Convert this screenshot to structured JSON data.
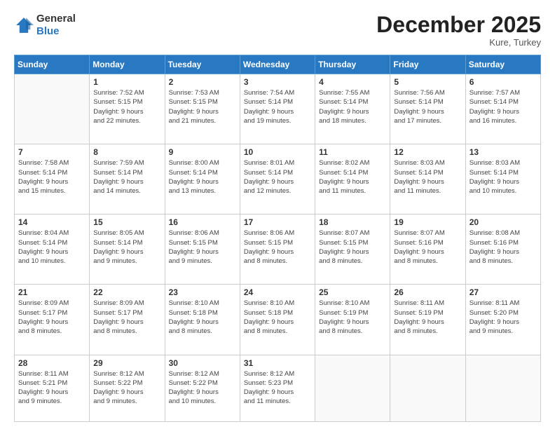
{
  "header": {
    "logo_line1": "General",
    "logo_line2": "Blue",
    "month": "December 2025",
    "location": "Kure, Turkey"
  },
  "weekdays": [
    "Sunday",
    "Monday",
    "Tuesday",
    "Wednesday",
    "Thursday",
    "Friday",
    "Saturday"
  ],
  "weeks": [
    [
      {
        "day": "",
        "sunrise": "",
        "sunset": "",
        "daylight": ""
      },
      {
        "day": "1",
        "sunrise": "Sunrise: 7:52 AM",
        "sunset": "Sunset: 5:15 PM",
        "daylight": "Daylight: 9 hours and 22 minutes."
      },
      {
        "day": "2",
        "sunrise": "Sunrise: 7:53 AM",
        "sunset": "Sunset: 5:15 PM",
        "daylight": "Daylight: 9 hours and 21 minutes."
      },
      {
        "day": "3",
        "sunrise": "Sunrise: 7:54 AM",
        "sunset": "Sunset: 5:14 PM",
        "daylight": "Daylight: 9 hours and 19 minutes."
      },
      {
        "day": "4",
        "sunrise": "Sunrise: 7:55 AM",
        "sunset": "Sunset: 5:14 PM",
        "daylight": "Daylight: 9 hours and 18 minutes."
      },
      {
        "day": "5",
        "sunrise": "Sunrise: 7:56 AM",
        "sunset": "Sunset: 5:14 PM",
        "daylight": "Daylight: 9 hours and 17 minutes."
      },
      {
        "day": "6",
        "sunrise": "Sunrise: 7:57 AM",
        "sunset": "Sunset: 5:14 PM",
        "daylight": "Daylight: 9 hours and 16 minutes."
      }
    ],
    [
      {
        "day": "7",
        "sunrise": "Sunrise: 7:58 AM",
        "sunset": "Sunset: 5:14 PM",
        "daylight": "Daylight: 9 hours and 15 minutes."
      },
      {
        "day": "8",
        "sunrise": "Sunrise: 7:59 AM",
        "sunset": "Sunset: 5:14 PM",
        "daylight": "Daylight: 9 hours and 14 minutes."
      },
      {
        "day": "9",
        "sunrise": "Sunrise: 8:00 AM",
        "sunset": "Sunset: 5:14 PM",
        "daylight": "Daylight: 9 hours and 13 minutes."
      },
      {
        "day": "10",
        "sunrise": "Sunrise: 8:01 AM",
        "sunset": "Sunset: 5:14 PM",
        "daylight": "Daylight: 9 hours and 12 minutes."
      },
      {
        "day": "11",
        "sunrise": "Sunrise: 8:02 AM",
        "sunset": "Sunset: 5:14 PM",
        "daylight": "Daylight: 9 hours and 11 minutes."
      },
      {
        "day": "12",
        "sunrise": "Sunrise: 8:03 AM",
        "sunset": "Sunset: 5:14 PM",
        "daylight": "Daylight: 9 hours and 11 minutes."
      },
      {
        "day": "13",
        "sunrise": "Sunrise: 8:03 AM",
        "sunset": "Sunset: 5:14 PM",
        "daylight": "Daylight: 9 hours and 10 minutes."
      }
    ],
    [
      {
        "day": "14",
        "sunrise": "Sunrise: 8:04 AM",
        "sunset": "Sunset: 5:14 PM",
        "daylight": "Daylight: 9 hours and 10 minutes."
      },
      {
        "day": "15",
        "sunrise": "Sunrise: 8:05 AM",
        "sunset": "Sunset: 5:14 PM",
        "daylight": "Daylight: 9 hours and 9 minutes."
      },
      {
        "day": "16",
        "sunrise": "Sunrise: 8:06 AM",
        "sunset": "Sunset: 5:15 PM",
        "daylight": "Daylight: 9 hours and 9 minutes."
      },
      {
        "day": "17",
        "sunrise": "Sunrise: 8:06 AM",
        "sunset": "Sunset: 5:15 PM",
        "daylight": "Daylight: 9 hours and 8 minutes."
      },
      {
        "day": "18",
        "sunrise": "Sunrise: 8:07 AM",
        "sunset": "Sunset: 5:15 PM",
        "daylight": "Daylight: 9 hours and 8 minutes."
      },
      {
        "day": "19",
        "sunrise": "Sunrise: 8:07 AM",
        "sunset": "Sunset: 5:16 PM",
        "daylight": "Daylight: 9 hours and 8 minutes."
      },
      {
        "day": "20",
        "sunrise": "Sunrise: 8:08 AM",
        "sunset": "Sunset: 5:16 PM",
        "daylight": "Daylight: 9 hours and 8 minutes."
      }
    ],
    [
      {
        "day": "21",
        "sunrise": "Sunrise: 8:09 AM",
        "sunset": "Sunset: 5:17 PM",
        "daylight": "Daylight: 9 hours and 8 minutes."
      },
      {
        "day": "22",
        "sunrise": "Sunrise: 8:09 AM",
        "sunset": "Sunset: 5:17 PM",
        "daylight": "Daylight: 9 hours and 8 minutes."
      },
      {
        "day": "23",
        "sunrise": "Sunrise: 8:10 AM",
        "sunset": "Sunset: 5:18 PM",
        "daylight": "Daylight: 9 hours and 8 minutes."
      },
      {
        "day": "24",
        "sunrise": "Sunrise: 8:10 AM",
        "sunset": "Sunset: 5:18 PM",
        "daylight": "Daylight: 9 hours and 8 minutes."
      },
      {
        "day": "25",
        "sunrise": "Sunrise: 8:10 AM",
        "sunset": "Sunset: 5:19 PM",
        "daylight": "Daylight: 9 hours and 8 minutes."
      },
      {
        "day": "26",
        "sunrise": "Sunrise: 8:11 AM",
        "sunset": "Sunset: 5:19 PM",
        "daylight": "Daylight: 9 hours and 8 minutes."
      },
      {
        "day": "27",
        "sunrise": "Sunrise: 8:11 AM",
        "sunset": "Sunset: 5:20 PM",
        "daylight": "Daylight: 9 hours and 9 minutes."
      }
    ],
    [
      {
        "day": "28",
        "sunrise": "Sunrise: 8:11 AM",
        "sunset": "Sunset: 5:21 PM",
        "daylight": "Daylight: 9 hours and 9 minutes."
      },
      {
        "day": "29",
        "sunrise": "Sunrise: 8:12 AM",
        "sunset": "Sunset: 5:22 PM",
        "daylight": "Daylight: 9 hours and 9 minutes."
      },
      {
        "day": "30",
        "sunrise": "Sunrise: 8:12 AM",
        "sunset": "Sunset: 5:22 PM",
        "daylight": "Daylight: 9 hours and 10 minutes."
      },
      {
        "day": "31",
        "sunrise": "Sunrise: 8:12 AM",
        "sunset": "Sunset: 5:23 PM",
        "daylight": "Daylight: 9 hours and 11 minutes."
      },
      {
        "day": "",
        "sunrise": "",
        "sunset": "",
        "daylight": ""
      },
      {
        "day": "",
        "sunrise": "",
        "sunset": "",
        "daylight": ""
      },
      {
        "day": "",
        "sunrise": "",
        "sunset": "",
        "daylight": ""
      }
    ]
  ]
}
